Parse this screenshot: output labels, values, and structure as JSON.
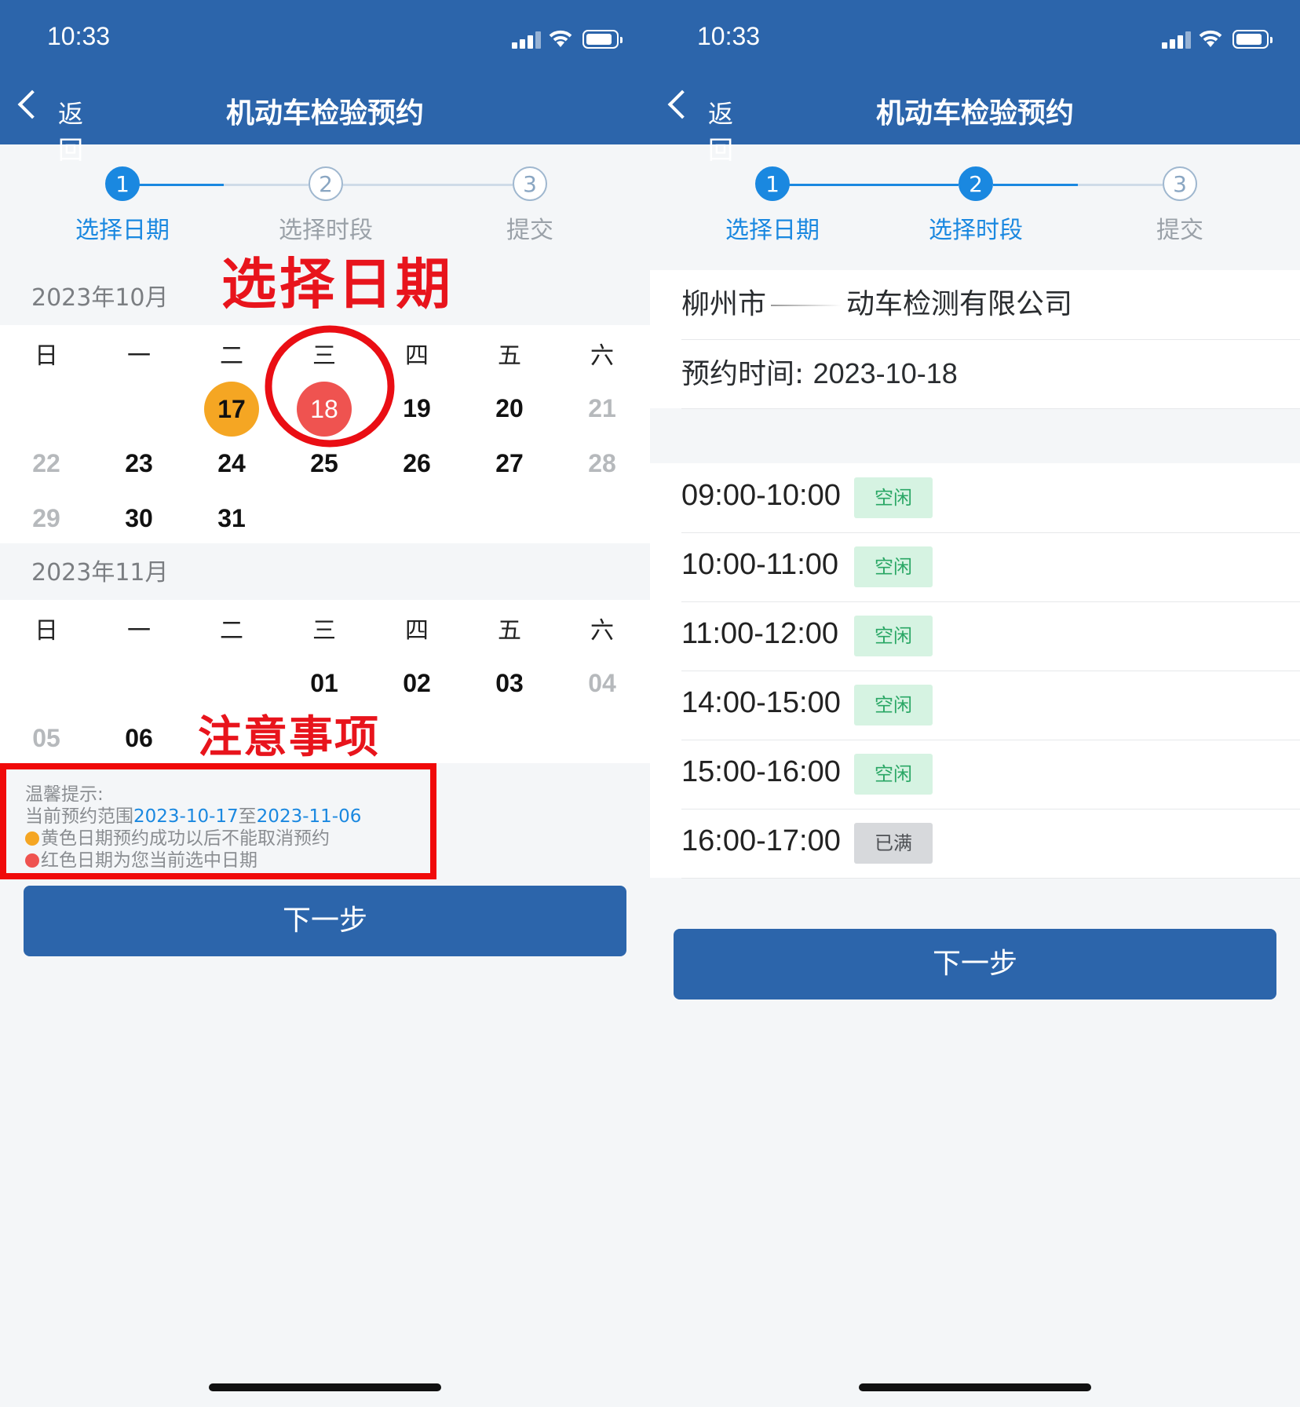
{
  "left_screen": {
    "status_time": "10:33",
    "back_label": "返回",
    "title": "机动车检验预约",
    "steps": [
      {
        "num": "1",
        "label": "选择日期",
        "active": true
      },
      {
        "num": "2",
        "label": "选择时段",
        "active": false
      },
      {
        "num": "3",
        "label": "提交",
        "active": false
      }
    ],
    "annotation_date": "选择日期",
    "annotation_notes": "注意事项",
    "october": {
      "header": "2023年10月",
      "weekdays": [
        "日",
        "一",
        "二",
        "三",
        "四",
        "五",
        "六"
      ],
      "rows": [
        [
          "",
          "",
          "17",
          "18",
          "19",
          "20",
          "21"
        ],
        [
          "22",
          "23",
          "24",
          "25",
          "26",
          "27",
          "28"
        ],
        [
          "29",
          "30",
          "31",
          "",
          "",
          "",
          ""
        ]
      ]
    },
    "november": {
      "header": "2023年11月",
      "weekdays": [
        "日",
        "一",
        "二",
        "三",
        "四",
        "五",
        "六"
      ],
      "rows": [
        [
          "",
          "",
          "",
          "01",
          "02",
          "03",
          "04"
        ],
        [
          "05",
          "06",
          "",
          "",
          "",
          "",
          ""
        ]
      ]
    },
    "tips": {
      "heading": "温馨提示:",
      "range_prefix": "当前预约范围",
      "range_start": "2023-10-17",
      "range_sep": "至",
      "range_end": "2023-11-06",
      "yellow_note": "黄色日期预约成功以后不能取消预约",
      "red_note": "红色日期为您当前选中日期"
    },
    "next_label": "下一步"
  },
  "right_screen": {
    "status_time": "10:33",
    "back_label": "返回",
    "title": "机动车检验预约",
    "steps": [
      {
        "num": "1",
        "label": "选择日期",
        "active": true
      },
      {
        "num": "2",
        "label": "选择时段",
        "active": true
      },
      {
        "num": "3",
        "label": "提交",
        "active": false
      }
    ],
    "company_prefix": "柳州市",
    "company_suffix": "动车检测有限公司",
    "appointment_label": "预约时间:",
    "appointment_date": "2023-10-18",
    "slots": [
      {
        "time": "09:00-10:00",
        "status": "空闲",
        "free": true
      },
      {
        "time": "10:00-11:00",
        "status": "空闲",
        "free": true
      },
      {
        "time": "11:00-12:00",
        "status": "空闲",
        "free": true
      },
      {
        "time": "14:00-15:00",
        "status": "空闲",
        "free": true
      },
      {
        "time": "15:00-16:00",
        "status": "空闲",
        "free": true
      },
      {
        "time": "16:00-17:00",
        "status": "已满",
        "free": false
      }
    ],
    "next_label": "下一步"
  },
  "colors": {
    "header_blue": "#2c65ab",
    "step_active": "#1a88e0",
    "yellow_date": "#f5a623",
    "red_date": "#ef5350",
    "annotation_red": "#e8141c"
  }
}
